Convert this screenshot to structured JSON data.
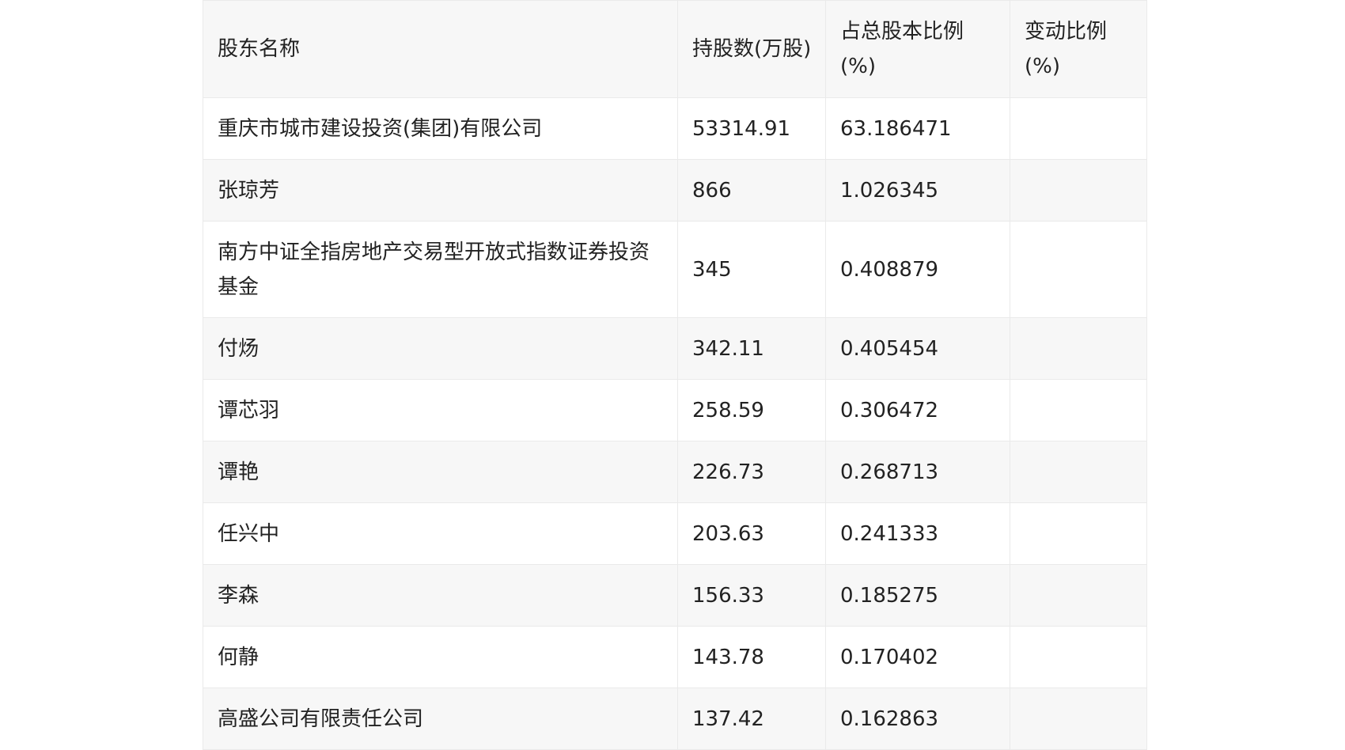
{
  "table": {
    "headers": [
      "股东名称",
      "持股数(万股)",
      "占总股本比例(%)",
      "变动比例(%)"
    ],
    "rows": [
      {
        "name": "重庆市城市建设投资(集团)有限公司",
        "shares": "53314.91",
        "ratio": "63.186471",
        "change": ""
      },
      {
        "name": "张琼芳",
        "shares": "866",
        "ratio": "1.026345",
        "change": ""
      },
      {
        "name": "南方中证全指房地产交易型开放式指数证券投资基金",
        "shares": "345",
        "ratio": "0.408879",
        "change": ""
      },
      {
        "name": "付炀",
        "shares": "342.11",
        "ratio": "0.405454",
        "change": ""
      },
      {
        "name": "谭芯羽",
        "shares": "258.59",
        "ratio": "0.306472",
        "change": ""
      },
      {
        "name": "谭艳",
        "shares": "226.73",
        "ratio": "0.268713",
        "change": ""
      },
      {
        "name": "任兴中",
        "shares": "203.63",
        "ratio": "0.241333",
        "change": ""
      },
      {
        "name": "李森",
        "shares": "156.33",
        "ratio": "0.185275",
        "change": ""
      },
      {
        "name": "何静",
        "shares": "143.78",
        "ratio": "0.170402",
        "change": ""
      },
      {
        "name": "高盛公司有限责任公司",
        "shares": "137.42",
        "ratio": "0.162863",
        "change": ""
      }
    ]
  }
}
